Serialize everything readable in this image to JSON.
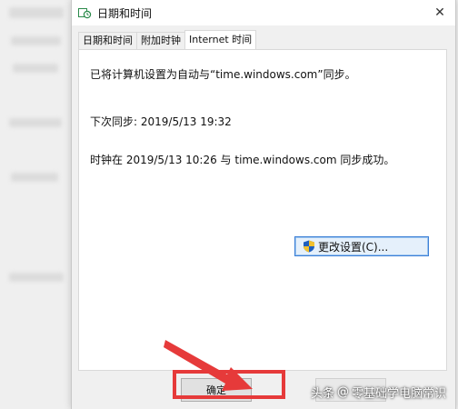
{
  "window": {
    "title": "日期和时间",
    "close_glyph": "✕"
  },
  "tabs": [
    {
      "label": "日期和时间",
      "active": false
    },
    {
      "label": "附加时钟",
      "active": false
    },
    {
      "label": "Internet 时间",
      "active": true
    }
  ],
  "panel": {
    "sync_message": "已将计算机设置为自动与“time.windows.com”同步。",
    "next_sync": "下次同步: 2019/5/13 19:32",
    "last_result": "时钟在 2019/5/13 10:26 与 time.windows.com 同步成功。",
    "change_settings_label": "更改设置(C)..."
  },
  "footer": {
    "ok_label": "确定"
  },
  "annotation": {
    "color": "#e63a3a"
  },
  "watermark": {
    "source": "头条",
    "separator": "@",
    "author": "零基础学电脑常识"
  },
  "icons": {
    "title": "datetime-app-icon",
    "shield": "uac-shield-icon"
  }
}
